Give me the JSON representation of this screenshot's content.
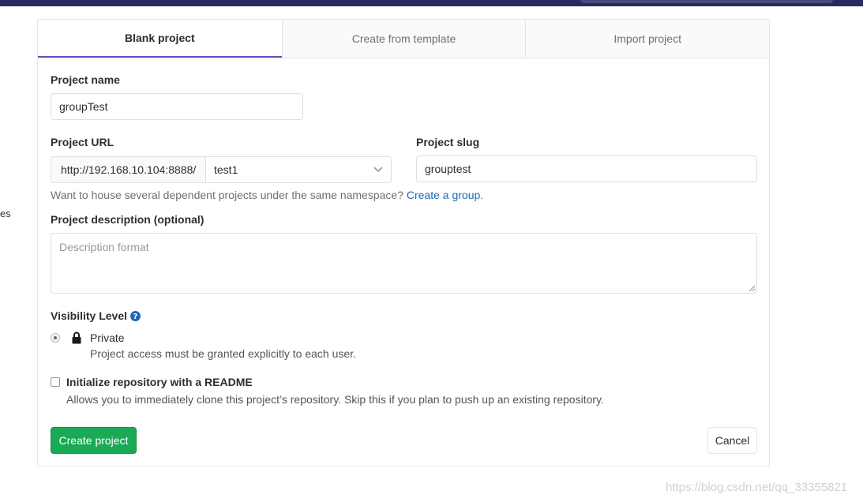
{
  "tabs": [
    {
      "label": "Blank project",
      "active": true
    },
    {
      "label": "Create from template",
      "active": false
    },
    {
      "label": "Import project",
      "active": false
    }
  ],
  "side_fragment": "es",
  "form": {
    "project_name_label": "Project name",
    "project_name_value": "groupTest",
    "project_url_label": "Project URL",
    "url_prefix": "http://192.168.10.104:8888/",
    "namespace_value": "test1",
    "project_slug_label": "Project slug",
    "project_slug_value": "grouptest",
    "help_text": "Want to house several dependent projects under the same namespace?",
    "help_link": "Create a group.",
    "description_label": "Project description (optional)",
    "description_placeholder": "Description format",
    "visibility_label": "Visibility Level",
    "visibility_option_label": "Private",
    "visibility_option_desc": "Project access must be granted explicitly to each user.",
    "readme_label": "Initialize repository with a README",
    "readme_desc": "Allows you to immediately clone this project’s repository. Skip this if you plan to push up an existing repository.",
    "create_button": "Create project",
    "cancel_button": "Cancel"
  },
  "colors": {
    "accent_tab": "#6b4fbb",
    "primary_button": "#1aaa55",
    "link": "#1b69b6",
    "topbar": "#292961"
  },
  "watermark": "https://blog.csdn.net/qq_33355821"
}
